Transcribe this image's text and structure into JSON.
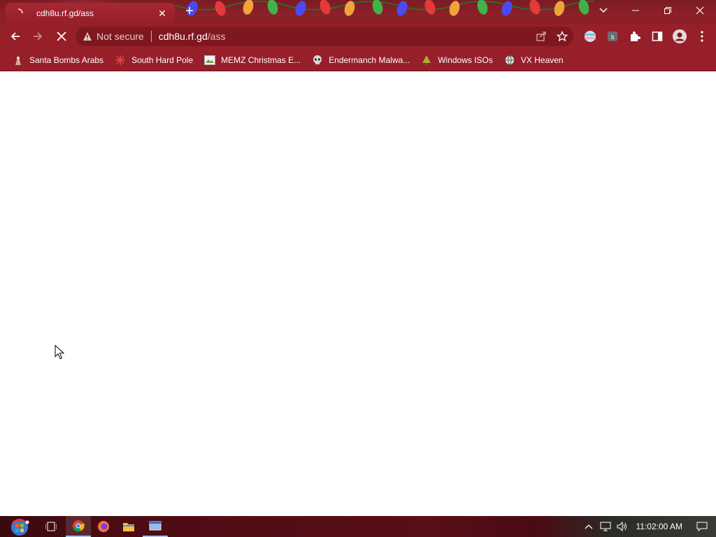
{
  "tab": {
    "title": "cdh8u.rf.gd/ass",
    "close_icon": "close-icon"
  },
  "window_controls": {
    "tab_search_icon": "chevron-down-icon",
    "minimize_icon": "minimize-icon",
    "restore_icon": "restore-icon",
    "close_icon": "close-icon"
  },
  "toolbar": {
    "security_label": "Not secure",
    "url_host": "cdh8u.rf.gd",
    "url_path": "/ass"
  },
  "bookmarks": [
    {
      "label": "Santa Bombs Arabs",
      "icon": "santa-icon"
    },
    {
      "label": "South Hard Pole",
      "icon": "snowflake-icon"
    },
    {
      "label": "MEMZ Christmas E...",
      "icon": "image-icon"
    },
    {
      "label": "Endermanch Malwa...",
      "icon": "skull-icon"
    },
    {
      "label": "Windows ISOs",
      "icon": "tree-icon"
    },
    {
      "label": "VX Heaven",
      "icon": "globe-icon"
    }
  ],
  "taskbar": {
    "clock": "11:02:00 AM"
  },
  "colors": {
    "frame": "#8d2029",
    "toolbar": "#961f29",
    "omnibox": "#7e1720"
  }
}
